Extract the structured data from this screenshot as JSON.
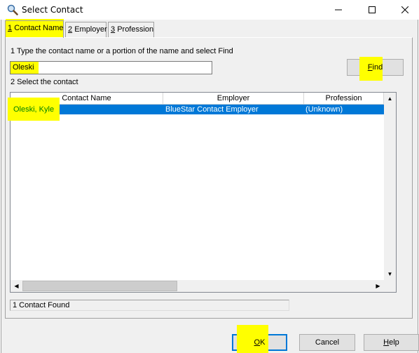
{
  "window": {
    "title": "Select Contact",
    "icon": "search-icon",
    "controls": [
      "minimize",
      "maximize",
      "close"
    ]
  },
  "tabs": [
    {
      "number": "1",
      "label": "Contact Name",
      "active": true
    },
    {
      "number": "2",
      "label": "Employer",
      "active": false
    },
    {
      "number": "3",
      "label": "Profession",
      "active": false
    }
  ],
  "step1": {
    "label": "1 Type the contact name or a portion of the name and select Find",
    "input_value": "Oleski",
    "find_button": {
      "mnemonic": "F",
      "rest": "ind"
    }
  },
  "step2": {
    "label": "2 Select the contact"
  },
  "table": {
    "columns": [
      "Contact Name",
      "Employer",
      "Profession"
    ],
    "rows": [
      {
        "name": "Oleski, Kyle",
        "employer": "BlueStar Contact Employer",
        "profession": "(Unknown)",
        "selected": true
      }
    ]
  },
  "status": "1 Contact Found",
  "buttons": {
    "ok": {
      "mnemonic": "O",
      "rest": "K"
    },
    "cancel": "Cancel",
    "help": {
      "mnemonic": "H",
      "rest": "elp"
    }
  },
  "colors": {
    "highlight": "#ffff00",
    "selection": "#0078d7",
    "dialog_bg": "#f0f0f0"
  }
}
